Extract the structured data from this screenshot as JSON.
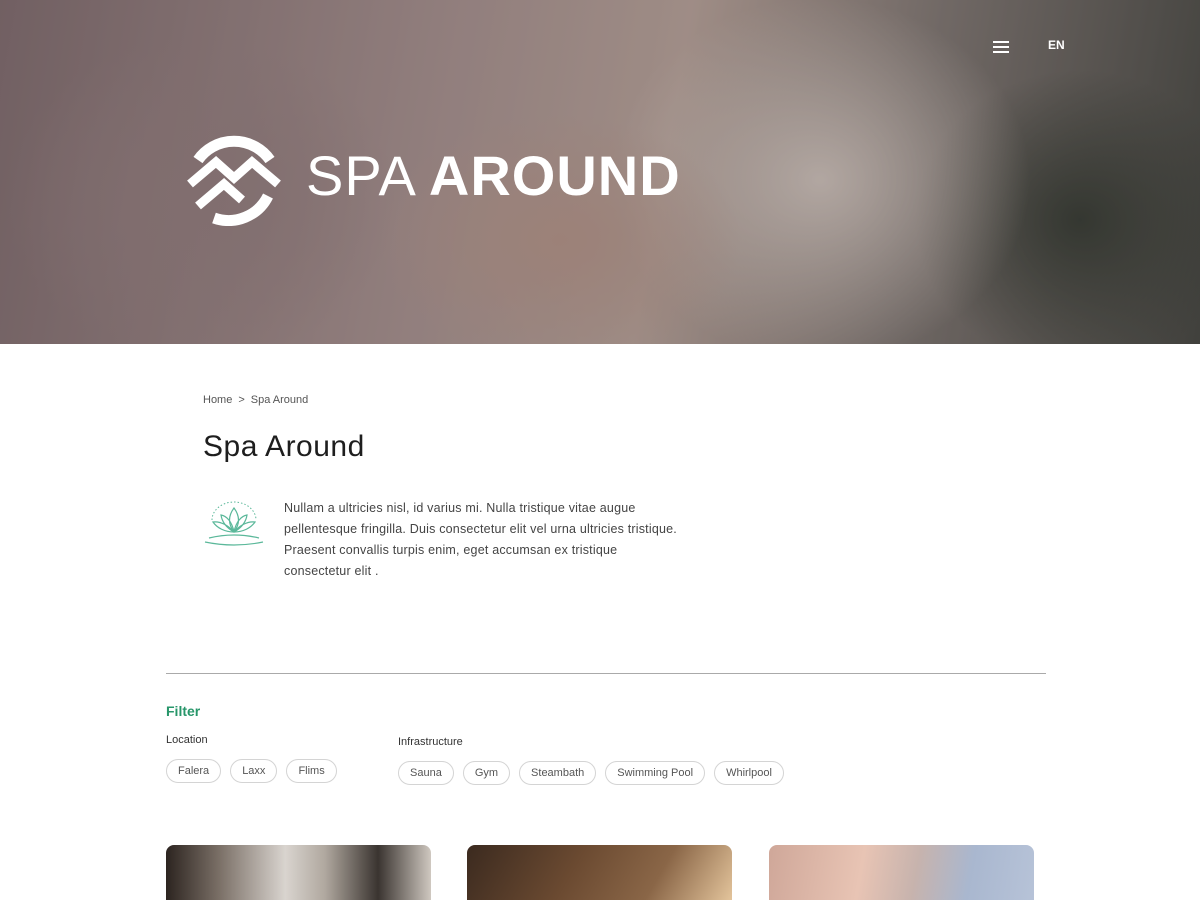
{
  "header": {
    "menu_icon": "hamburger-menu-icon",
    "language": "EN",
    "logo": {
      "text_light": "SPA",
      "text_bold": "AROUND",
      "icon": "mountain-circle-logo-icon"
    }
  },
  "breadcrumb": {
    "home": "Home",
    "separator": ">",
    "current": "Spa Around"
  },
  "page": {
    "title": "Spa Around",
    "intro_icon": "lotus-icon",
    "intro_text": "Nullam a ultricies nisl, id varius mi. Nulla tristique vitae augue pellentesque fringilla. Duis consectetur elit vel urna ultricies tristique. Praesent convallis turpis enim, eget accumsan ex tristique consectetur elit ."
  },
  "filter": {
    "title": "Filter",
    "location": {
      "label": "Location",
      "options": [
        "Falera",
        "Laxx",
        "Flims"
      ]
    },
    "infrastructure": {
      "label": "Infrastructure",
      "options": [
        "Sauna",
        "Gym",
        "Steambath",
        "Swimming Pool",
        "Whirlpool"
      ]
    }
  },
  "colors": {
    "accent": "#27966a",
    "lotus": "#5bb89a"
  }
}
